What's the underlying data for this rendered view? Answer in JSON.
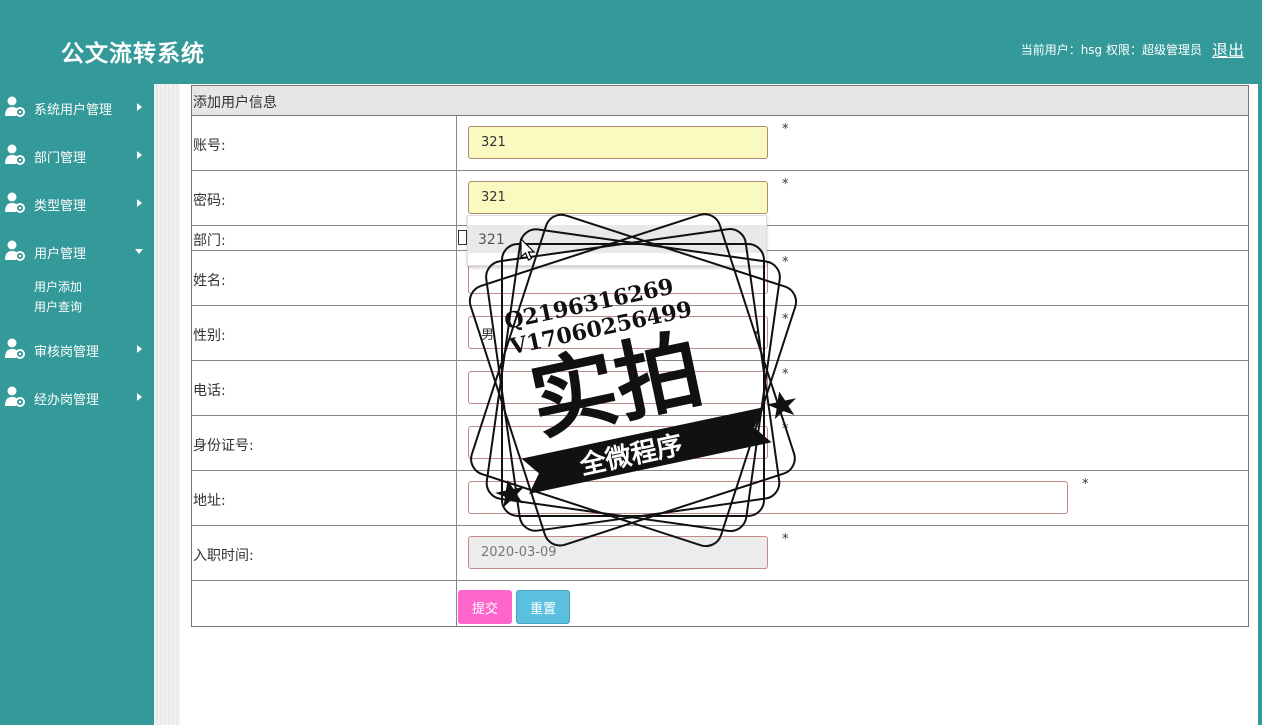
{
  "header": {
    "title": "公文流转系统",
    "user_info": "当前用户：hsg  权限：超级管理员",
    "logout": "退出"
  },
  "sidebar": {
    "items": [
      {
        "label": "系统用户管理"
      },
      {
        "label": "部门管理"
      },
      {
        "label": "类型管理"
      },
      {
        "label": "用户管理",
        "expanded": true,
        "children": [
          {
            "label": "用户添加"
          },
          {
            "label": "用户查询"
          }
        ]
      },
      {
        "label": "审核岗管理"
      },
      {
        "label": "经办岗管理"
      }
    ]
  },
  "form": {
    "title": "添加用户信息",
    "fields": {
      "account": {
        "label": "账号:",
        "value": "321"
      },
      "password": {
        "label": "密码:",
        "value": "321"
      },
      "department": {
        "label": "部门:"
      },
      "name": {
        "label": "姓名:",
        "value": ""
      },
      "gender": {
        "label": "性别:",
        "value": "男"
      },
      "phone": {
        "label": "电话:",
        "value": ""
      },
      "id_number": {
        "label": "身份证号:",
        "value": ""
      },
      "address": {
        "label": "地址:",
        "value": ""
      },
      "hire_date": {
        "label": "入职时间:",
        "value": "2020-03-09"
      }
    },
    "required_mark": "*",
    "submit_label": "提交",
    "reset_label": "重置"
  },
  "autocomplete": {
    "suggestion": "321"
  },
  "watermark": {
    "line1": "Q2196316269",
    "line2": "V17060256499",
    "main": "实拍",
    "banner": "全微程序"
  },
  "colors": {
    "accent": "#339999",
    "submit": "#ff66cc",
    "reset": "#5bc0de",
    "autofill": "#fafac0"
  }
}
